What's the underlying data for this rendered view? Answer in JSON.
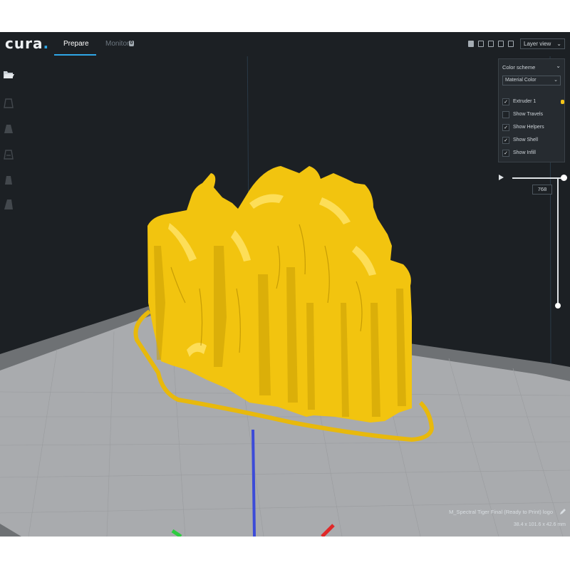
{
  "app": {
    "logo_text": "cura",
    "logo_dot": ".",
    "accent_color": "#2fa6e6",
    "background_color": "#1c2024"
  },
  "header": {
    "tabs": [
      {
        "label": "Prepare",
        "active": true
      },
      {
        "label": "Monitor",
        "active": false,
        "badge": "0"
      }
    ],
    "view_icons": [
      "3d-view-icon",
      "front-view-icon",
      "top-view-icon",
      "left-view-icon",
      "right-view-icon"
    ],
    "view_mode": "Layer view"
  },
  "toolbar": {
    "tools": [
      "open-file-icon",
      "move-tool-icon",
      "scale-tool-icon",
      "rotate-tool-icon",
      "mirror-tool-icon",
      "support-blocker-icon"
    ]
  },
  "color_scheme_panel": {
    "title": "Color scheme",
    "selected_scheme": "Material Color",
    "options": [
      {
        "label": "Extruder 1",
        "checked": true,
        "swatch_color": "#f6c518"
      },
      {
        "label": "Show Travels",
        "checked": false
      },
      {
        "label": "Show Helpers",
        "checked": true
      },
      {
        "label": "Show Shell",
        "checked": true
      },
      {
        "label": "Show Infill",
        "checked": true
      }
    ]
  },
  "layer_slider": {
    "current_layer": "768"
  },
  "model": {
    "color": "#f2c40f",
    "name": "M_Spectral Tiger Final (Ready to Print) logo",
    "dimensions": "38.4 x 101.6 x 42.6 mm"
  },
  "build_plate": {
    "grid_color": "#a9abae",
    "border_color": "#6e7174"
  }
}
